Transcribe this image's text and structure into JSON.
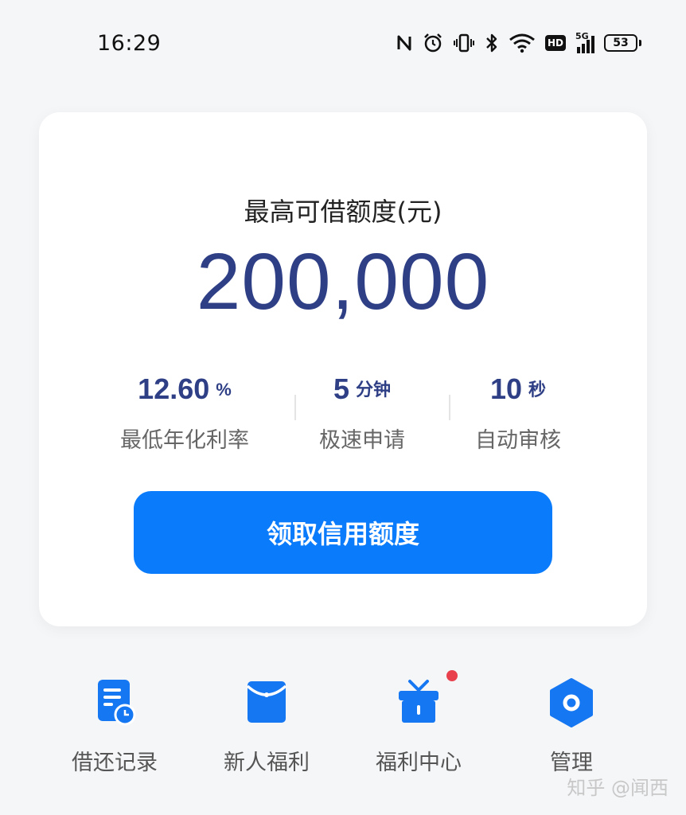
{
  "status_bar": {
    "time": "16:29",
    "network": "5G",
    "hd_label": "HD",
    "battery": "53",
    "icons": [
      "nfc-icon",
      "alarm-icon",
      "vibrate-icon",
      "bluetooth-icon",
      "wifi-icon",
      "hd-icon",
      "signal-icon",
      "battery-icon"
    ]
  },
  "card": {
    "title": "最高可借额度(元)",
    "amount": "200,000",
    "stats": [
      {
        "value": "12.60",
        "unit": "%",
        "label": "最低年化利率"
      },
      {
        "value": "5",
        "unit": "分钟",
        "label": "极速申请"
      },
      {
        "value": "10",
        "unit": "秒",
        "label": "自动审核"
      }
    ],
    "cta_label": "领取信用额度",
    "accent_color": "#0a7bfa",
    "amount_color": "#2f3f86"
  },
  "shortcuts": [
    {
      "label": "借还记录",
      "icon": "record-clock-icon",
      "badge": false
    },
    {
      "label": "新人福利",
      "icon": "red-envelope-icon",
      "badge": false
    },
    {
      "label": "福利中心",
      "icon": "gift-icon",
      "badge": true
    },
    {
      "label": "管理",
      "icon": "hexagon-settings-icon",
      "badge": false
    }
  ],
  "watermark": "知乎 @闻西"
}
